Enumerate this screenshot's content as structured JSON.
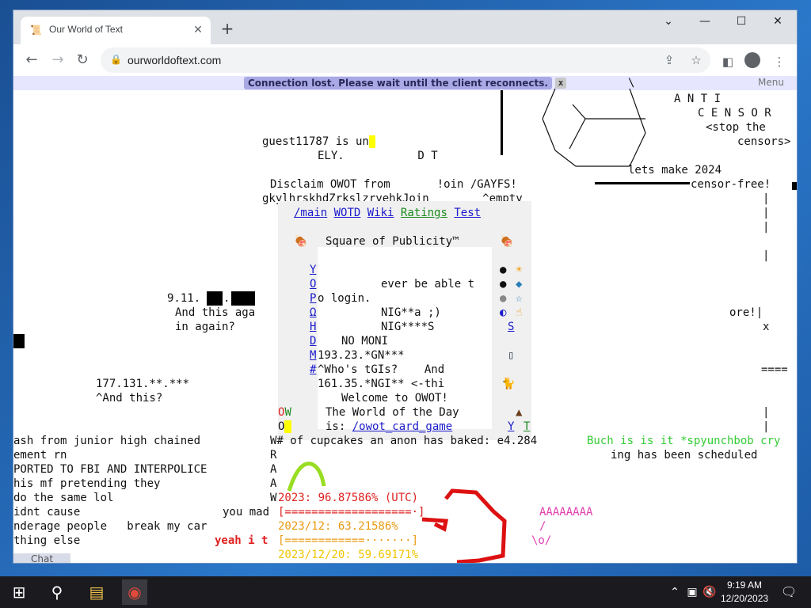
{
  "browser": {
    "tab_title": "Our World of Text",
    "url": "ourworldoftext.com",
    "icons": [
      "scroll-favicon",
      "close-icon",
      "plus-icon",
      "back-icon",
      "forward-icon",
      "reload-icon",
      "lock-icon",
      "share-icon",
      "star-icon",
      "sidebar-icon",
      "profile-icon",
      "menu-icon",
      "chevron-down-icon",
      "minimize-icon",
      "maximize-icon",
      "close-window-icon"
    ]
  },
  "banner": {
    "message": "Connection lost. Please wait until the client reconnects.",
    "close": "x",
    "menu": "Menu"
  },
  "world": {
    "l_top1": "\\",
    "l_anti": "A N T I",
    "l_censor": "C E N S O R",
    "l_stop": "<stop the",
    "l_censors": "censors>",
    "l_lets": "lets make 2024",
    "l_cfree": "censor-free!",
    "l_guest": "guest11787 is un",
    "l_ely": "ELY.           D T",
    "l_disclaim": "Disclaim OWOT from       !oin /GAYFS!",
    "l_gky": "gkylhrskhdZrkslzryehkJoin        ^empty",
    "l_911": "9.11.",
    "l_andthis": "And this aga",
    "l_inagain": "in again?",
    "l_ore": "ore!",
    "l_x": "x",
    "l_ip1": "177.131.**.***",
    "l_andthis2": "^And this?",
    "l_eq": "====",
    "l_lash": "ash from junior high chained",
    "l_ement": "ement rn",
    "l_reported": "PORTED TO FBI AND INTERPOLICE",
    "l_thismf": "his mf pretending they",
    "l_dothesame": "do the same lol",
    "l_dnt": "idnt cause",
    "l_youmad": "you mad",
    "l_underage": "nderage people   break my car",
    "l_thing": "thing else",
    "l_yeah": "yeah i t",
    "l_w": "W# of cupcakes an anon has baked: e4.284",
    "l_bsuch": "Buch is is it *spyunchbob cry",
    "l_ing": "ing has been scheduled",
    "l_R": "R",
    "l_A1": "A",
    "l_A2": "A",
    "l_W2": "W",
    "l_2023": "2023: 96.87586% (UTC)",
    "l_bar1": "[===================·]",
    "l_20231": "2023/12: 63.21586%",
    "l_bar2": "[============·······]",
    "l_20232": "2023/12/20: 59.69171%",
    "l_aaaa": "AAAAAAAA",
    "l_slash": "/",
    "l_man": "\\o/"
  },
  "panel": {
    "nav": [
      "/main",
      "WOTD",
      "Wiki",
      "Ratings",
      "Test"
    ],
    "title": "Square of Publicity™",
    "side": [
      "Y",
      "O",
      "P",
      "Ω",
      "H",
      "D",
      "M",
      "#"
    ],
    "ever": "ever be able t",
    "login": "o login.",
    "nig1": "NIG**a ;)",
    "nig2": "NIG****S",
    "nomoni": "NO MONI",
    "ip193": "193.23.*GN***",
    "who": "^Who's tGIs?    And",
    "ip161": "161.35.*NGI** <-thi",
    "welcome": "Welcome to OWOT!",
    "wotd": "The World of the Day",
    "is": "is: ",
    "wotd_link": "/owot_card_game",
    "ow": "OW",
    "o": "O",
    "s_link": "S",
    "y": "Y",
    "t": "T"
  },
  "chat": {
    "label": "Chat"
  },
  "taskbar": {
    "time": "9:19 AM",
    "date": "12/20/2023",
    "icons": [
      "windows-start-icon",
      "search-icon",
      "file-explorer-icon",
      "chrome-icon",
      "chevron-up-icon",
      "network-icon",
      "volume-muted-icon",
      "notifications-icon"
    ]
  }
}
